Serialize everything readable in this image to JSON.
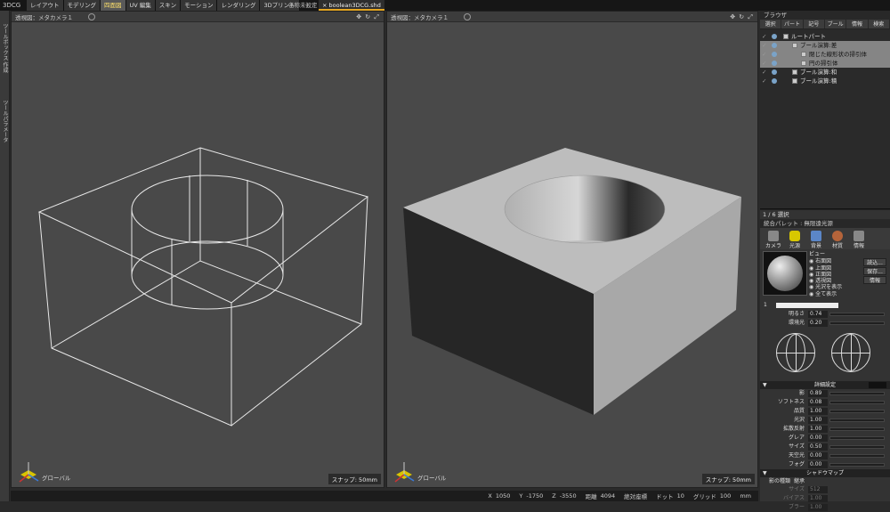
{
  "app": {
    "title": "3DCG"
  },
  "menu_tabs": [
    {
      "label": "レイアウト",
      "active": false
    },
    {
      "label": "モデリング",
      "active": false
    },
    {
      "label": "四面図",
      "active": true
    },
    {
      "label": "UV 編集",
      "active": false
    },
    {
      "label": "スキン",
      "active": false
    },
    {
      "label": "モーション",
      "active": false
    },
    {
      "label": "レンダリング",
      "active": false
    },
    {
      "label": "3Dプリント",
      "active": false
    }
  ],
  "menu_add": "+ -",
  "doc_tabs": {
    "unset": "名称未設定",
    "current": "× boolean3DCG.shd"
  },
  "left_strip": {
    "tab1": "ツールボックス 作成",
    "tab2": "ツールパラメータ"
  },
  "viewports": [
    {
      "title": "透視図：メタカメラ１",
      "snap": "スナップ: 50mm",
      "axis": "グローバル",
      "mode": "wireframe"
    },
    {
      "title": "透視図：メタカメラ１",
      "snap": "スナップ: 50mm",
      "axis": "グローバル",
      "mode": "shaded"
    }
  ],
  "viewport_tools": "✥ ↻ ⤢",
  "status": [
    {
      "label": "X",
      "value": "1050"
    },
    {
      "label": "Y",
      "value": "-1750"
    },
    {
      "label": "Z",
      "value": "-3550"
    },
    {
      "label": "距離",
      "value": "4094"
    },
    {
      "label": "絶対座標",
      "value": ""
    },
    {
      "label": "ドット",
      "value": "10"
    },
    {
      "label": "グリッド",
      "value": "100"
    },
    {
      "label": "mm",
      "value": ""
    }
  ],
  "browser": {
    "title": "ブラウザ",
    "tabs": [
      "選択",
      "パート",
      "記号",
      "ブール",
      "情報",
      "検索"
    ],
    "tree": [
      {
        "label": "ルートパート",
        "selected": false,
        "depth": 0,
        "kind": "part"
      },
      {
        "label": "ブール演算:差",
        "selected": true,
        "depth": 1,
        "kind": "bool"
      },
      {
        "label": "閉じた線形状の掃引体",
        "selected": true,
        "depth": 2,
        "kind": "shape"
      },
      {
        "label": "円の掃引体",
        "selected": true,
        "depth": 2,
        "kind": "shape"
      },
      {
        "label": "ブール演算:和",
        "selected": false,
        "depth": 1,
        "kind": "bool"
      },
      {
        "label": "ブール演算:積",
        "selected": false,
        "depth": 1,
        "kind": "bool"
      }
    ],
    "selection_count": "1 / 6 選択"
  },
  "palette": {
    "title": "統合パレット : 無限遠光源",
    "icons": [
      {
        "label": "カメラ",
        "name": "camera-icon",
        "active": false
      },
      {
        "label": "光源",
        "name": "light-icon",
        "active": true
      },
      {
        "label": "背景",
        "name": "background-icon",
        "active": false
      },
      {
        "label": "材質",
        "name": "material-icon",
        "active": false
      },
      {
        "label": "情報",
        "name": "info-icon",
        "active": false
      }
    ],
    "view_heading": "ビュー",
    "views": [
      "右面図",
      "上面図",
      "正面図",
      "透視図",
      "光沢を表示",
      "全て表示"
    ],
    "buttons": [
      "読込...",
      "保存...",
      "情報"
    ],
    "color_index": "1",
    "sliders_top": [
      {
        "label": "明るさ",
        "value": "0.74"
      },
      {
        "label": "環境光",
        "value": "0.20"
      }
    ],
    "detail_heading": "詳細設定",
    "sliders_detail": [
      {
        "label": "影",
        "value": "0.89"
      },
      {
        "label": "ソフトネス",
        "value": "0.08"
      },
      {
        "label": "品質",
        "value": "1.00"
      },
      {
        "label": "光沢",
        "value": "1.00"
      },
      {
        "label": "拡散反射",
        "value": "1.00"
      },
      {
        "label": "グレア",
        "value": "0.00"
      },
      {
        "label": "サイズ",
        "value": "0.50"
      },
      {
        "label": "天空光",
        "value": "0.00"
      },
      {
        "label": "フォグ",
        "value": "0.00"
      }
    ],
    "shadow_heading": "シャドウマップ",
    "shadow_type_label": "影の種類",
    "shadow_type_value": "継承",
    "shadow_rows": [
      {
        "label": "サイズ",
        "value": "512"
      },
      {
        "label": "バイアス",
        "value": "1.00"
      },
      {
        "label": "ブラー",
        "value": "1.00"
      }
    ]
  },
  "colors": {
    "accent": "#e3a521",
    "selected_row": "#858585",
    "viewport_bg": "#494949"
  }
}
